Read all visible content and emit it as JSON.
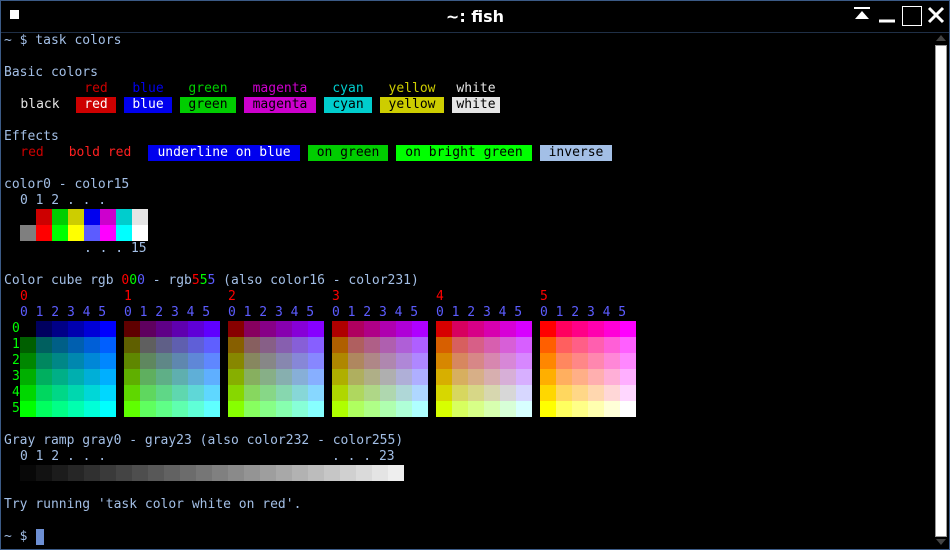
{
  "window": {
    "title": "~: fish"
  },
  "terminal": {
    "line_command": "~ $ task colors",
    "basic_heading": "Basic colors",
    "effects_heading": "Effects",
    "color16_heading": "color0 - color15",
    "color16_digits": "0 1 2 . . .",
    "color16_end": ". . . 15",
    "cube_heading_pre": "Color cube rgb",
    "cube_heading_r": "0",
    "cube_heading_g": "0",
    "cube_heading_b": "0",
    "cube_heading_mid": " - rgb",
    "cube_heading_r2": "5",
    "cube_heading_g2": "5",
    "cube_heading_b2": "5",
    "cube_heading_post": " (also color16 - color231)",
    "gray_heading": "Gray ramp gray0 - gray23 (also color232 - color255)",
    "gray_digits": "0 1 2 . . .",
    "gray_end": ". . . 23",
    "try_line": "Try running 'task color white on red'.",
    "prompt": "~ $ "
  },
  "basic_fg": [
    {
      "label": "red",
      "color": "#cd0000"
    },
    {
      "label": "blue",
      "color": "#0000ee"
    },
    {
      "label": "green",
      "color": "#00cd00"
    },
    {
      "label": "magenta",
      "color": "#cd00cd"
    },
    {
      "label": "cyan",
      "color": "#00cdcd"
    },
    {
      "label": "yellow",
      "color": "#cdcd00"
    },
    {
      "label": "white",
      "color": "#e5e5e5"
    }
  ],
  "basic_bg": [
    {
      "label": "black",
      "bg": "#000000",
      "fg": "#e5e5e5"
    },
    {
      "label": "red",
      "bg": "#cd0000",
      "fg": "#ffffff"
    },
    {
      "label": "blue",
      "bg": "#0000ee",
      "fg": "#ffffff"
    },
    {
      "label": "green",
      "bg": "#00cd00",
      "fg": "#000000"
    },
    {
      "label": "magenta",
      "bg": "#cd00cd",
      "fg": "#000000"
    },
    {
      "label": "cyan",
      "bg": "#00cdcd",
      "fg": "#000000"
    },
    {
      "label": "yellow",
      "bg": "#cdcd00",
      "fg": "#000000"
    },
    {
      "label": "white",
      "bg": "#e5e5e5",
      "fg": "#000000"
    }
  ],
  "effects": [
    {
      "label": "red",
      "bg": "transparent",
      "fg": "#cd0000",
      "bold": false
    },
    {
      "label": "bold red",
      "bg": "transparent",
      "fg": "#ff2020",
      "bold": false
    },
    {
      "label": "underline on blue",
      "bg": "#0000ee",
      "fg": "#ffffff",
      "bold": false
    },
    {
      "label": "on green",
      "bg": "#00cd00",
      "fg": "#000000",
      "bold": false
    },
    {
      "label": "on bright green",
      "bg": "#00ff00",
      "fg": "#000000",
      "bold": false
    },
    {
      "label": "inverse",
      "bg": "#a3bfe6",
      "fg": "#000000",
      "bold": false
    }
  ],
  "color16": [
    "#000000",
    "#cd0000",
    "#00cd00",
    "#cdcd00",
    "#0000ee",
    "#cd00cd",
    "#00cdcd",
    "#e5e5e5",
    "#7f7f7f",
    "#ff0000",
    "#00ff00",
    "#ffff00",
    "#5c5cff",
    "#ff00ff",
    "#00ffff",
    "#ffffff"
  ],
  "cube": {
    "r_labels": [
      "0",
      "1",
      "2",
      "3",
      "4",
      "5"
    ],
    "gb_digits": "0 1 2 3 4 5",
    "g_labels": [
      "0",
      "1",
      "2",
      "3",
      "4",
      "5"
    ]
  },
  "gray_steps": 24,
  "colors": {
    "text": "#a3bfe6",
    "digit": "#6d8fd3",
    "red_label": "#ff0000",
    "green_label": "#00ff00",
    "blue_label": "#5c5cff"
  }
}
